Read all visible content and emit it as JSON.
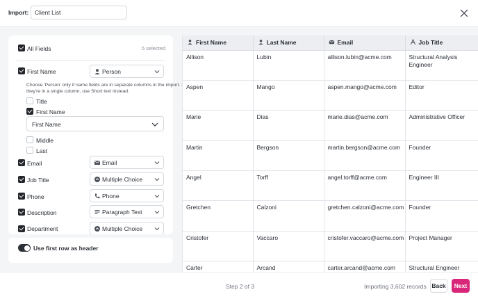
{
  "header": {
    "import_label": "Import:",
    "import_value": "Client List"
  },
  "fields_panel": {
    "all_fields_label": "All Fields",
    "selected_count": "5 selected",
    "first_name": {
      "label": "First Name",
      "type": "Person",
      "type_icon": "person-icon",
      "help_text": "Choose 'Person' only if name fields are in separate columns in the import. If they're in a single column, use Short text instead.",
      "subfields": [
        {
          "label": "Title",
          "checked": false
        },
        {
          "label": "First Name",
          "checked": true
        },
        {
          "label": "Middle",
          "checked": false
        },
        {
          "label": "Last",
          "checked": false
        }
      ],
      "mapping_value": "First Name"
    },
    "fields": [
      {
        "label": "Email",
        "type": "Email",
        "type_icon": "envelope-icon",
        "checked": true
      },
      {
        "label": "Job Title",
        "type": "Multiple Choice",
        "type_icon": "choice-icon",
        "checked": true
      },
      {
        "label": "Phone",
        "type": "Phone",
        "type_icon": "phone-icon",
        "checked": true
      },
      {
        "label": "Description",
        "type": "Paragraph Text",
        "type_icon": "paragraph-icon",
        "checked": true
      },
      {
        "label": "Department",
        "type": "Multiple Choice",
        "type_icon": "choice-icon",
        "checked": true
      }
    ],
    "header_toggle_label": "Use first row as header",
    "header_toggle_on": true
  },
  "table": {
    "columns": [
      {
        "label": "First Name",
        "icon": "person-icon"
      },
      {
        "label": "Last Name",
        "icon": "person-icon"
      },
      {
        "label": "Email",
        "icon": "envelope-icon"
      },
      {
        "label": "Job Title",
        "icon": "text-icon"
      }
    ],
    "rows": [
      [
        "Allison",
        "Lubin",
        "allison.lubin@acme.com",
        "Structural Analysis Engineer"
      ],
      [
        "Aspen",
        "Mango",
        "aspen.mango@acme.com",
        "Editor"
      ],
      [
        "Marie",
        "Dias",
        "marie.dias@acme.com",
        "Administrative Officer"
      ],
      [
        "Martin",
        "Bergson",
        "martin.bergson@acme.com",
        "Founder"
      ],
      [
        "Angel",
        "Torff",
        "angel.torff@acme.com",
        "Engineer III"
      ],
      [
        "Gretchen",
        "Calzoni",
        "gretchen.calzoni@acme.com",
        "Founder"
      ],
      [
        "Cristofer",
        "Vaccaro",
        "cristofer.vaccaro@acme.com",
        "Project Manager"
      ],
      [
        "Carter",
        "Arcand",
        "carter.arcand@acme.com",
        "Structural Engineer"
      ]
    ]
  },
  "footer": {
    "step_text": "Step 2 of 3",
    "importing_text": "Importing 3,602 records",
    "back_label": "Back",
    "next_label": "Next"
  },
  "colors": {
    "accent": "#d8277a",
    "checkbox": "#24262b",
    "table_header_bg": "#eceef1",
    "panel_bg": "#f4f5f7"
  }
}
